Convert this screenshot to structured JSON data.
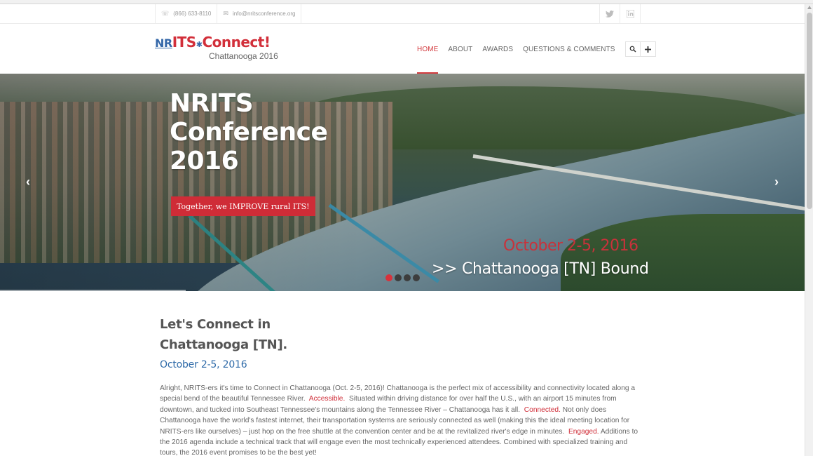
{
  "topbar": {
    "phone": "(866) 633-8110",
    "email": "info@nritsconference.org",
    "social": [
      "twitter-icon",
      "linkedin-icon"
    ]
  },
  "logo": {
    "prefix": "NR",
    "its": "ITS",
    "connect": "Connect!",
    "subtitle": "Chattanooga 2016"
  },
  "nav": {
    "items": [
      "HOME",
      "ABOUT",
      "AWARDS",
      "QUESTIONS & COMMENTS"
    ],
    "active": "HOME"
  },
  "hero": {
    "title": "NRITS Conference 2016",
    "cta": "Together, we IMPROVE rural ITS!",
    "date": "October 2-5, 2016",
    "location": ">> Chattanooga [TN] Bound",
    "slide_count": 4,
    "active_slide": 1
  },
  "content": {
    "heading": "Let's Connect in Chattanooga [TN].",
    "date": "October 2-5, 2016",
    "para_1": "Alright, NRITS-ers it's time to Connect in Chattanooga (Oct. 2-5, 2016)! Chattanooga is the perfect mix of accessibility and connectivity located along a special bend of the beautiful Tennessee River.",
    "hl_accessible": "Accessible.",
    "para_2": "Situated within driving distance for over half the U.S., with an airport 15 minutes from downtown, and tucked into Southeast Tennessee's mountains along the Tennessee River – Chattanooga has it all.",
    "hl_connected": "Connected.",
    "para_3": "Not only does Chattanooga have the world's fastest internet, their transportation systems are seriously connected as well (making this the ideal meeting location for NRITS-ers like ourselves) – just hop on the free shuttle at the convention center and be at the revitalized river's edge in minutes.",
    "hl_engaged": "Engaged.",
    "para_4": "Additions to the 2016 agenda include a technical track that will engage even the most technically experienced attendees. Combined with specialized training and tours, the 2016 event promises to be the best yet!"
  },
  "colors": {
    "accent_red": "#cf2c37",
    "accent_blue": "#2e6aa8"
  }
}
